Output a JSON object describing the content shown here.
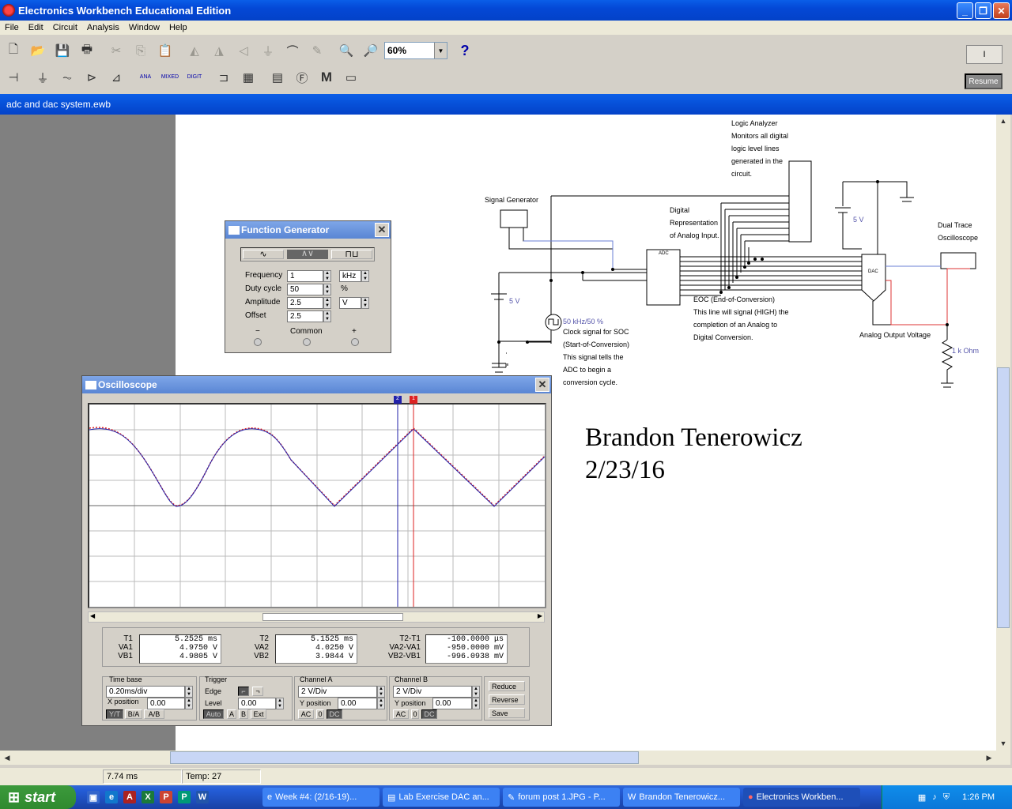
{
  "app": {
    "title": "Electronics Workbench Educational Edition",
    "document_title": "adc and dac system.ewb"
  },
  "menu": [
    "File",
    "Edit",
    "Circuit",
    "Analysis",
    "Window",
    "Help"
  ],
  "toolbar": {
    "zoom": "60%",
    "help": "?",
    "resume": "Resume",
    "power": "I"
  },
  "toolbar2": {
    "ana": "ANA",
    "mixed": "MIXED",
    "digit": "DIGIT",
    "m": "M"
  },
  "fg": {
    "title": "Function Generator",
    "rows": [
      {
        "label": "Frequency",
        "value": "1",
        "unit": "kHz"
      },
      {
        "label": "Duty cycle",
        "value": "50",
        "unit": "%"
      },
      {
        "label": "Amplitude",
        "value": "2.5",
        "unit": "V"
      },
      {
        "label": "Offset",
        "value": "2.5",
        "unit": ""
      }
    ],
    "terminals": {
      "minus": "−",
      "common": "Common",
      "plus": "+"
    }
  },
  "scope": {
    "title": "Oscilloscope",
    "readout": [
      {
        "labels": [
          "T1",
          "VA1",
          "VB1"
        ],
        "values": [
          "5.2525  ms",
          "4.9750   V",
          "4.9805   V"
        ]
      },
      {
        "labels": [
          "T2",
          "VA2",
          "VB2"
        ],
        "values": [
          "5.1525  ms",
          "4.0250   V",
          "3.9844   V"
        ]
      },
      {
        "labels": [
          "T2-T1",
          "VA2-VA1",
          "VB2-VB1"
        ],
        "values": [
          "-100.0000  μs",
          "-950.0000  mV",
          "-996.0938  mV"
        ]
      }
    ],
    "timebase": {
      "title": "Time base",
      "value": "0.20ms/div",
      "xpos_label": "X position",
      "xpos": "0.00",
      "buttons": [
        "Y/T",
        "B/A",
        "A/B"
      ]
    },
    "trigger": {
      "title": "Trigger",
      "edge_label": "Edge",
      "level_label": "Level",
      "level": "0.00",
      "buttons": [
        "Auto",
        "A",
        "B",
        "Ext"
      ]
    },
    "chA": {
      "title": "Channel A",
      "value": "2 V/Div",
      "ypos_label": "Y position",
      "ypos": "0.00",
      "buttons": [
        "AC",
        "0",
        "DC"
      ]
    },
    "chB": {
      "title": "Channel B",
      "value": "2 V/Div",
      "ypos_label": "Y position",
      "ypos": "0.00",
      "buttons": [
        "AC",
        "0",
        "DC"
      ]
    },
    "actions": [
      "Reduce",
      "Reverse",
      "Save"
    ],
    "cursor1": "1",
    "cursor2": "2"
  },
  "circuit": {
    "logic_analyzer": [
      "Logic Analyzer",
      "Monitors all digital",
      "logic level lines",
      "generated in the",
      "circuit."
    ],
    "signal_generator": "Signal Generator",
    "digital_rep": [
      "Digital",
      "Representation",
      "of Analog Input."
    ],
    "dual_trace": [
      "Dual Trace",
      "Oscilloscope"
    ],
    "eoc": [
      "EOC (End-of-Conversion)",
      "This line will signal (HIGH) the",
      "completion of an Analog to",
      "Digital Conversion."
    ],
    "clock": [
      "Clock signal for SOC",
      "(Start-of-Conversion)",
      "This signal tells the",
      "ADC to begin a",
      "conversion cycle."
    ],
    "clock_label": "50 kHz/50 %",
    "analog_out": "Analog Output Voltage",
    "resistor": "1 k Ohm",
    "v5a": "5 V",
    "v5b": "5 V",
    "adc": "ADC",
    "dac": "DAC",
    "author": "Brandon Tenerowicz",
    "date": "2/23/16"
  },
  "status": {
    "time": "7.74 ms",
    "temp": "Temp: 27"
  },
  "taskbar": {
    "start": "start",
    "tasks": [
      "Week #4: (2/16-19)...",
      "Lab Exercise DAC an...",
      "forum post 1.JPG - P...",
      "Brandon Tenerowicz...",
      "Electronics Workben..."
    ],
    "clock": "1:26 PM"
  }
}
